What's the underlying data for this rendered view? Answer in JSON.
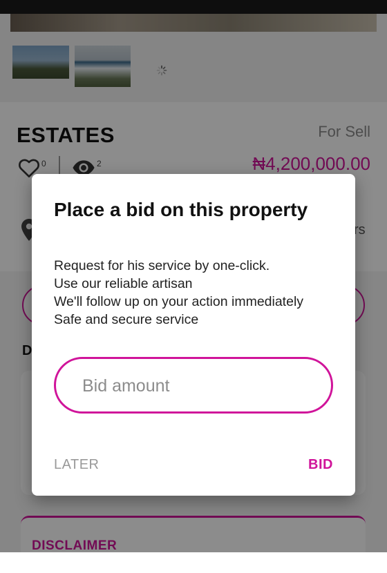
{
  "property": {
    "title": "ESTATES",
    "sale_type": "For Sell",
    "price": "₦4,200,000.00",
    "likes": "0",
    "views": "2",
    "location_suffix": "rs"
  },
  "sections": {
    "description_initial": "D",
    "disclaimer_title": "DISCLAIMER"
  },
  "dialog": {
    "title": "Place a bid on this property",
    "body_lines": [
      "Request for his service by one-click.",
      "Use our reliable artisan",
      "We'll follow up on your action immediately",
      "Safe and secure service"
    ],
    "bid_placeholder": "Bid amount",
    "bid_value": "",
    "later_label": "LATER",
    "bid_label": "BID"
  },
  "colors": {
    "accent": "#d0149a",
    "status_bar": "#1b1b1b",
    "scrim": "rgba(0,0,0,0.45)"
  },
  "icons": {
    "like": "heart-icon",
    "views": "eye-icon",
    "location": "map-pin-icon",
    "loading": "loading-spinner-icon"
  }
}
